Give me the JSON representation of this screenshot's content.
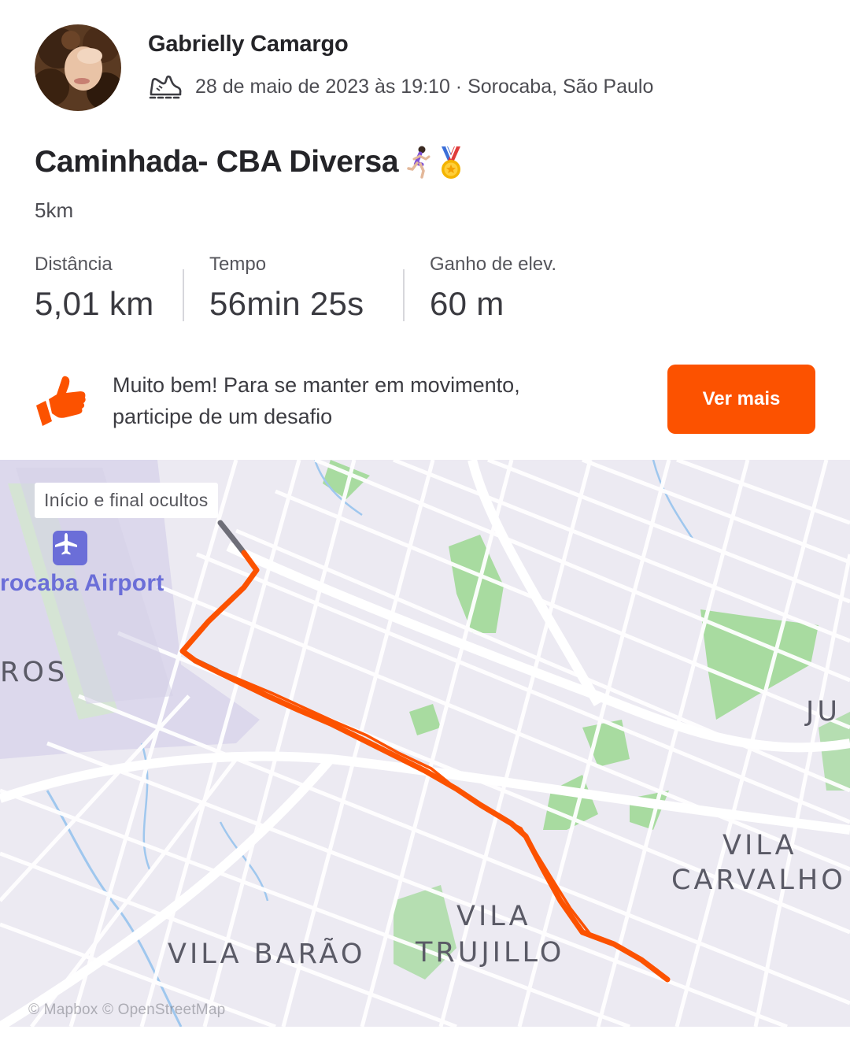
{
  "header": {
    "athlete_name": "Gabrielly Camargo",
    "sport_icon": "walking-shoe-icon",
    "meta": "28 de maio de 2023 às 19:10 · Sorocaba, São Paulo"
  },
  "activity": {
    "title": "Caminhada- CBA Diversa",
    "title_emojis": [
      "woman-running-icon",
      "medal-icon"
    ],
    "description": "5km"
  },
  "stats": [
    {
      "label": "Distância",
      "value": "5,01 km"
    },
    {
      "label": "Tempo",
      "value": "56min 25s"
    },
    {
      "label": "Ganho de elev.",
      "value": "60 m"
    }
  ],
  "challenge": {
    "icon": "thumbs-up-icon",
    "text_line1": "Muito bem! Para se manter em movimento,",
    "text_line2": "participe de um desafio",
    "button_label": "Ver mais"
  },
  "map": {
    "badge": "Início e final ocultos",
    "airport_label": "rocaba Airport",
    "labels": {
      "ros": "ROS",
      "ju": "JU",
      "vila_carvalho_1": "VILA",
      "vila_carvalho_2": "CARVALHO",
      "vila_trujillo_1": "VILA",
      "vila_trujillo_2": "TRUJILLO",
      "vila_barao": "VILA BARÃO"
    },
    "attribution": "© Mapbox © OpenStreetMap"
  },
  "colors": {
    "brand": "#fc5200",
    "route": "#fc5200",
    "hidden_route": "#6e6e78",
    "park": "#a8dba0",
    "water": "#9fc7ee",
    "airport": "#6b6ed8"
  }
}
